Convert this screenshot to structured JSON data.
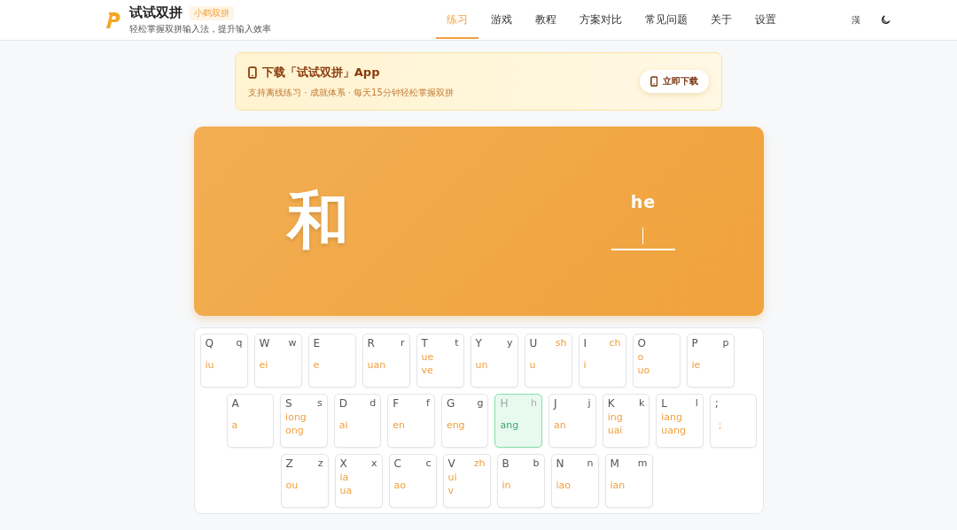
{
  "brand": {
    "title": "试试双拼",
    "badge": "小鹤双拼",
    "subtitle": "轻松掌握双拼输入法，提升输入效率"
  },
  "nav": [
    {
      "label": "练习",
      "selected": true
    },
    {
      "label": "游戏",
      "selected": false
    },
    {
      "label": "教程",
      "selected": false
    },
    {
      "label": "方案对比",
      "selected": false
    },
    {
      "label": "常见问题",
      "selected": false
    },
    {
      "label": "关于",
      "selected": false
    },
    {
      "label": "设置",
      "selected": false
    }
  ],
  "script_toggle": "漢",
  "banner": {
    "title": "下载「试试双拼」App",
    "subtitle": "支持离线练习 · 成就体系 · 每天15分钟轻松掌握双拼",
    "button": "立即下载"
  },
  "practice": {
    "character": "和",
    "pinyin": "he"
  },
  "keyboard": [
    [
      {
        "key": "Q",
        "initial": "q",
        "finals": [
          "iu"
        ],
        "selected": false
      },
      {
        "key": "W",
        "initial": "w",
        "finals": [
          "ei"
        ],
        "selected": false
      },
      {
        "key": "E",
        "finals": [
          "e"
        ],
        "selected": false
      },
      {
        "key": "R",
        "initial": "r",
        "finals": [
          "uan"
        ],
        "selected": false
      },
      {
        "key": "T",
        "initial": "t",
        "finals": [
          "ue",
          "ve"
        ],
        "selected": false
      },
      {
        "key": "Y",
        "initial": "y",
        "finals": [
          "un"
        ],
        "selected": false
      },
      {
        "key": "U",
        "initial": "sh",
        "compound": true,
        "finals": [
          "u"
        ],
        "selected": false
      },
      {
        "key": "I",
        "initial": "ch",
        "compound": true,
        "finals": [
          "i"
        ],
        "selected": false
      },
      {
        "key": "O",
        "finals": [
          "o",
          "uo"
        ],
        "selected": false
      },
      {
        "key": "P",
        "initial": "p",
        "finals": [
          "ie"
        ],
        "selected": false
      }
    ],
    [
      {
        "key": "A",
        "finals": [
          "a"
        ],
        "selected": false
      },
      {
        "key": "S",
        "initial": "s",
        "finals": [
          "iong",
          "ong"
        ],
        "selected": false
      },
      {
        "key": "D",
        "initial": "d",
        "finals": [
          "ai"
        ],
        "selected": false
      },
      {
        "key": "F",
        "initial": "f",
        "finals": [
          "en"
        ],
        "selected": false
      },
      {
        "key": "G",
        "initial": "g",
        "finals": [
          "eng"
        ],
        "selected": false
      },
      {
        "key": "H",
        "initial": "h",
        "finals": [
          "ang"
        ],
        "selected": true
      },
      {
        "key": "J",
        "initial": "j",
        "finals": [
          "an"
        ],
        "selected": false
      },
      {
        "key": "K",
        "initial": "k",
        "finals": [
          "ing",
          "uai"
        ],
        "selected": false
      },
      {
        "key": "L",
        "initial": "l",
        "finals": [
          "iang",
          "uang"
        ],
        "selected": false
      },
      {
        "key": ";",
        "finals": [
          "；"
        ],
        "selected": false
      }
    ],
    [
      {
        "key": "Z",
        "initial": "z",
        "finals": [
          "ou"
        ],
        "selected": false
      },
      {
        "key": "X",
        "initial": "x",
        "finals": [
          "ia",
          "ua"
        ],
        "selected": false
      },
      {
        "key": "C",
        "initial": "c",
        "finals": [
          "ao"
        ],
        "selected": false
      },
      {
        "key": "V",
        "initial": "zh",
        "compound": true,
        "finals": [
          "ui",
          "v"
        ],
        "selected": false
      },
      {
        "key": "B",
        "initial": "b",
        "finals": [
          "in"
        ],
        "selected": false
      },
      {
        "key": "N",
        "initial": "n",
        "finals": [
          "iao"
        ],
        "selected": false
      },
      {
        "key": "M",
        "initial": "m",
        "finals": [
          "ian"
        ],
        "selected": false
      }
    ]
  ]
}
